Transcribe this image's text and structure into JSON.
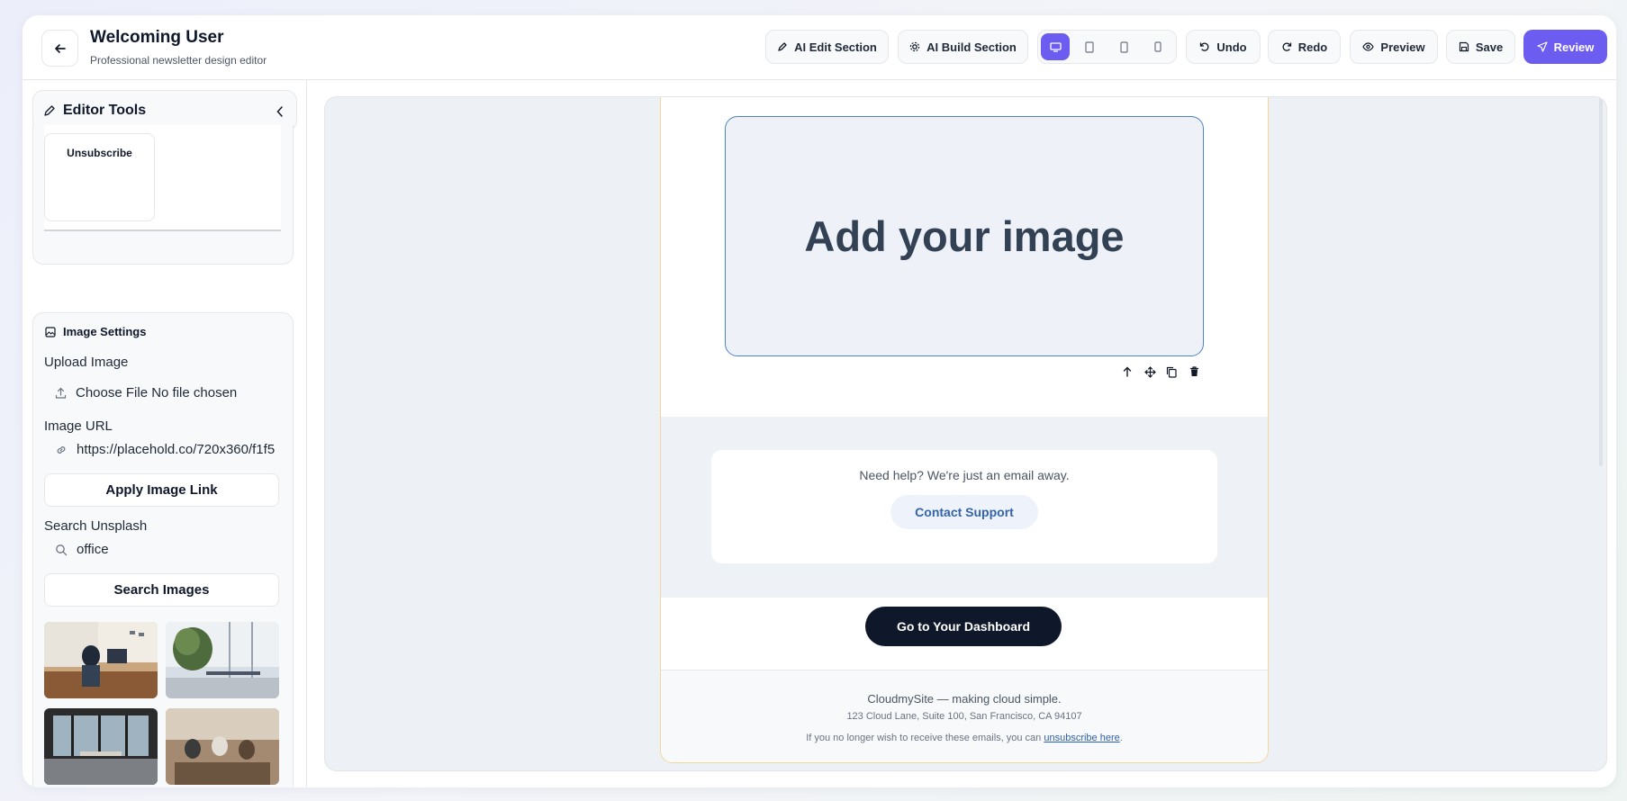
{
  "header": {
    "title": "Welcoming User",
    "subtitle": "Professional newsletter design editor",
    "ai_edit_label": "AI Edit Section",
    "ai_build_label": "AI Build Section",
    "undo_label": "Undo",
    "redo_label": "Redo",
    "preview_label": "Preview",
    "save_label": "Save",
    "review_label": "Review",
    "devices": [
      "desktop-icon",
      "tablet-icon",
      "tablet-portrait-icon",
      "mobile-icon"
    ],
    "active_device": "desktop"
  },
  "sidebar": {
    "title": "Editor Tools",
    "preview_block_label": "Unsubscribe",
    "image_settings": {
      "title": "Image Settings",
      "upload_label": "Upload Image",
      "file_text": "Choose File No file chosen",
      "url_label": "Image URL",
      "url_value": "https://placehold.co/720x360/f1f5",
      "apply_label": "Apply Image Link",
      "search_label": "Search Unsplash",
      "search_value": "office",
      "search_button": "Search Images"
    }
  },
  "email": {
    "image_placeholder": "Add your image",
    "help_text": "Need help? We're just an email away.",
    "contact_label": "Contact Support",
    "dashboard_label": "Go to Your Dashboard",
    "footer_line1": "CloudmySite — making cloud simple.",
    "footer_line2": "123 Cloud Lane, Suite 100, San Francisco, CA 94107",
    "footer_line3_prefix": "If you no longer wish to receive these emails, you can ",
    "footer_link": "unsubscribe here",
    "footer_line3_suffix": "."
  },
  "colors": {
    "accent": "#6d5cf0",
    "dark_button": "#0f172a",
    "selection_border": "#4c84c4"
  }
}
